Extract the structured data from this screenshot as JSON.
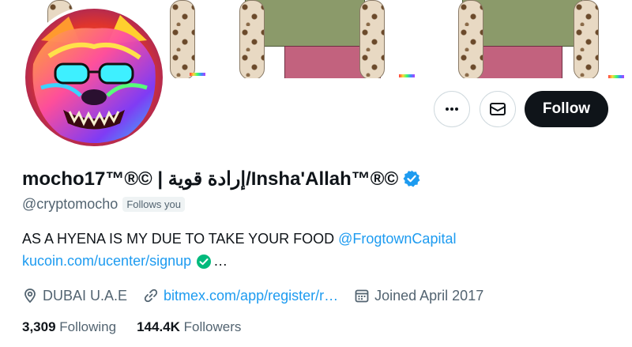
{
  "profile": {
    "display_name": "mocho17™®© | إرادة قوية/Insha'Allah™®©",
    "handle": "@cryptomocho",
    "follows_you_badge": "Follows you",
    "bio": {
      "text": "AS A HYENA IS MY DUE TO TAKE YOUR FOOD ",
      "mention": "@FrogtownCapital",
      "link": "kucoin.com/ucenter/signup",
      "ellipsis": "…"
    },
    "location": "DUBAI U.A.E",
    "website": "bitmex.com/app/register/r…",
    "joined": "Joined April 2017",
    "following_count": "3,309",
    "following_label": "Following",
    "followers_count": "144.4K",
    "followers_label": "Followers"
  },
  "actions": {
    "more_icon": "more-icon",
    "message_icon": "envelope-icon",
    "follow_label": "Follow"
  },
  "colors": {
    "accent": "#1d9bf0",
    "follow_bg": "#0f1419",
    "muted_text": "#536471",
    "verified_green": "#00ba7c"
  }
}
